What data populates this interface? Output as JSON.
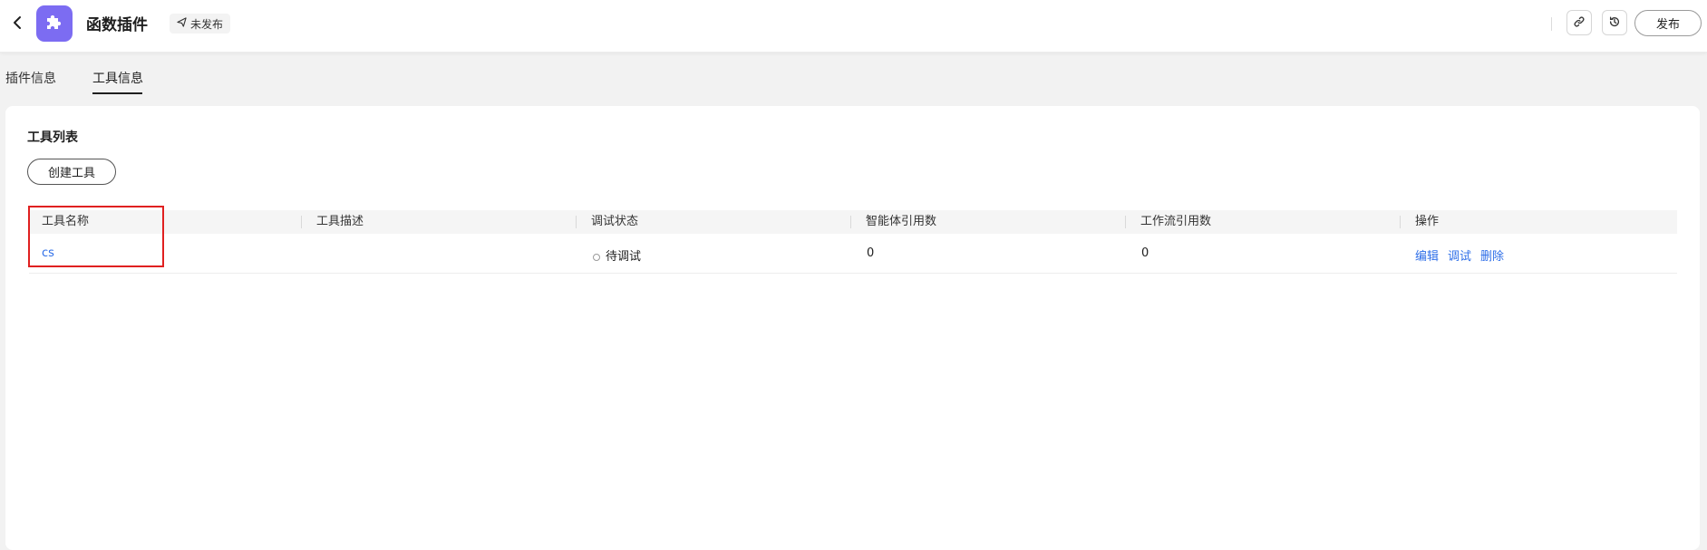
{
  "header": {
    "title": "函数插件",
    "status": "未发布",
    "publish_label": "发布",
    "back_icon": "chevron-left-icon",
    "app_icon": "puzzle-icon",
    "link_icon": "link-icon",
    "history_icon": "history-icon",
    "brand_color": "#7c6cf2"
  },
  "tabs": [
    {
      "label": "插件信息",
      "active": false
    },
    {
      "label": "工具信息",
      "active": true
    }
  ],
  "tools": {
    "section_title": "工具列表",
    "create_label": "创建工具",
    "columns": [
      "工具名称",
      "工具描述",
      "调试状态",
      "智能体引用数",
      "工作流引用数",
      "操作"
    ],
    "rows": [
      {
        "name": "cs",
        "description": "",
        "debug_status": "待调试",
        "agent_refs": "0",
        "workflow_refs": "0",
        "actions": [
          "编辑",
          "调试",
          "删除"
        ]
      }
    ]
  },
  "accent_link_color": "#2f6fe8",
  "highlight_color": "#e02020"
}
